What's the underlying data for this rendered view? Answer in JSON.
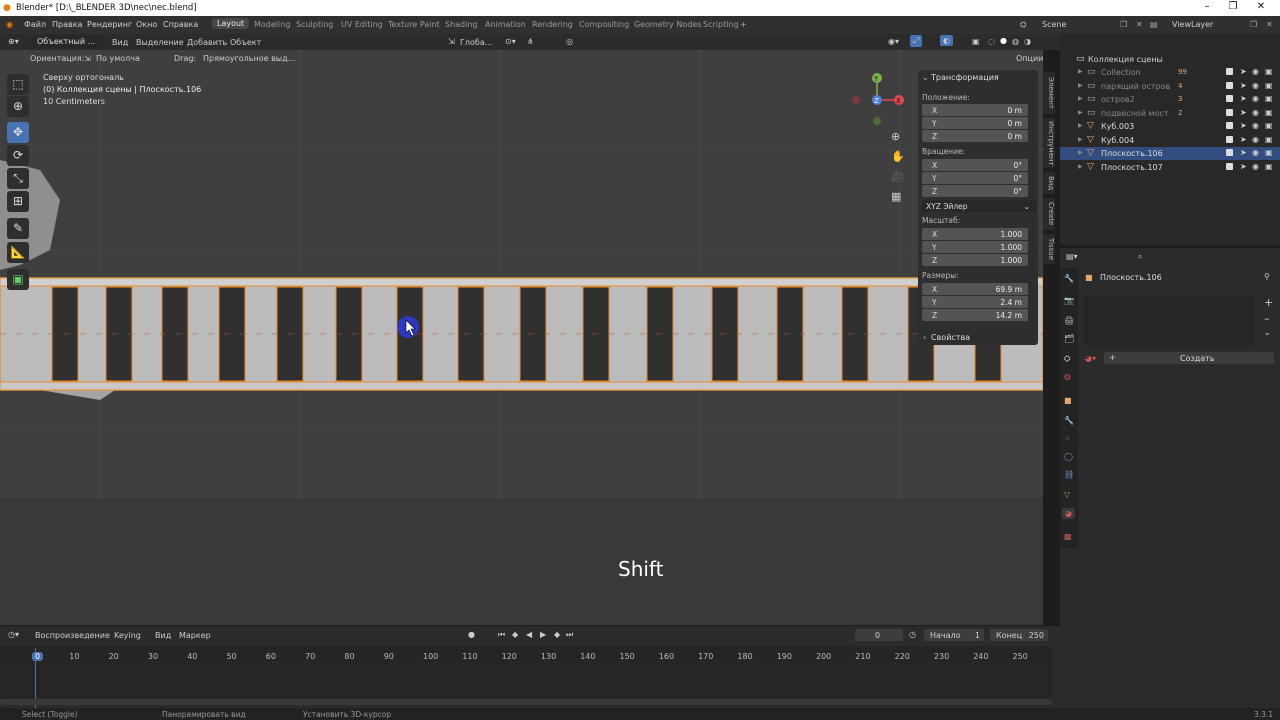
{
  "titlebar": {
    "title": "Blender* [D:\\_BLENDER 3D\\nec\\nec.blend]"
  },
  "menu": {
    "file": "Файл",
    "edit": "Правка",
    "render": "Рендеринг",
    "window": "Окно",
    "help": "Справка"
  },
  "workspaces": [
    "Layout",
    "Modeling",
    "Sculpting",
    "UV Editing",
    "Texture Paint",
    "Shading",
    "Animation",
    "Rendering",
    "Compositing",
    "Geometry Nodes",
    "Scripting"
  ],
  "topright": {
    "scene": "Scene",
    "viewlayer": "ViewLayer"
  },
  "viewport_header": {
    "mode": "Объектный ...",
    "view": "Вид",
    "select": "Выделение",
    "add": "Добавить",
    "object": "Объект",
    "transform_orientation": "Глоба...",
    "options": "Опции"
  },
  "tool_settings": {
    "orientation_label": "Ориентация:",
    "orientation_value": "По умолча",
    "drag_label": "Drag:",
    "drag_value": "Прямоугольное выд..."
  },
  "overlay_text": {
    "view_name": "Сверху ортогональ",
    "collection": "(0) Коллекция сцены | Плоскость.106",
    "scale": "10 Centimeters"
  },
  "gizmo": {
    "x": "X",
    "y": "Y",
    "z": "Z"
  },
  "key_hint": "Shift",
  "npanel": {
    "title": "Трансформация",
    "location_label": "Положение:",
    "location": [
      {
        "axis": "X",
        "value": "0 m"
      },
      {
        "axis": "Y",
        "value": "0 m"
      },
      {
        "axis": "Z",
        "value": "0 m"
      }
    ],
    "rotation_label": "Вращение:",
    "rotation": [
      {
        "axis": "X",
        "value": "0°"
      },
      {
        "axis": "Y",
        "value": "0°"
      },
      {
        "axis": "Z",
        "value": "0°"
      }
    ],
    "rotation_mode": "XYZ Эйлер",
    "scale_label": "Масштаб:",
    "scale": [
      {
        "axis": "X",
        "value": "1.000"
      },
      {
        "axis": "Y",
        "value": "1.000"
      },
      {
        "axis": "Z",
        "value": "1.000"
      }
    ],
    "dimensions_label": "Размеры:",
    "dimensions": [
      {
        "axis": "X",
        "value": "69.9 m"
      },
      {
        "axis": "Y",
        "value": "2.4 m"
      },
      {
        "axis": "Z",
        "value": "14.2 m"
      }
    ],
    "properties": "Свойства",
    "tabs": [
      "Элемент",
      "Инструмент",
      "Вид",
      "Create",
      "Tissue"
    ]
  },
  "outliner": {
    "root": "Коллекция сцены",
    "items": [
      {
        "name": "Collection",
        "badge": "99"
      },
      {
        "name": "парящий остров",
        "badge": "4"
      },
      {
        "name": "остров2",
        "badge": "3"
      },
      {
        "name": "подвесной мост",
        "badge": "2"
      },
      {
        "name": "Куб.003",
        "badge": ""
      },
      {
        "name": "Куб.004",
        "badge": ""
      },
      {
        "name": "Плоскость.106",
        "badge": ""
      },
      {
        "name": "Плоскость.107",
        "badge": ""
      }
    ]
  },
  "properties": {
    "object_name": "Плоскость.106",
    "new_button": "Создать"
  },
  "timeline": {
    "playback": "Воспроизведение",
    "keying": "Keying",
    "view": "Вид",
    "marker": "Маркер",
    "current_frame": "0",
    "start_label": "Начало",
    "start_value": "1",
    "end_label": "Конец",
    "end_value": "250",
    "ticks": [
      "0",
      "10",
      "20",
      "30",
      "40",
      "50",
      "60",
      "70",
      "80",
      "90",
      "100",
      "110",
      "120",
      "130",
      "140",
      "150",
      "160",
      "170",
      "180",
      "190",
      "200",
      "210",
      "220",
      "230",
      "240",
      "250"
    ]
  },
  "statusbar": {
    "select": "Select (Toggle)",
    "pan": "Панорамировать вид",
    "cursor": "Установить 3D-курсор",
    "version": "3.3.1"
  },
  "colors": {
    "accent": "#4772b3",
    "selection": "#e58d2e",
    "x_axis": "#e0474f",
    "y_axis": "#7ab34a",
    "z_axis": "#4f7ee0"
  }
}
